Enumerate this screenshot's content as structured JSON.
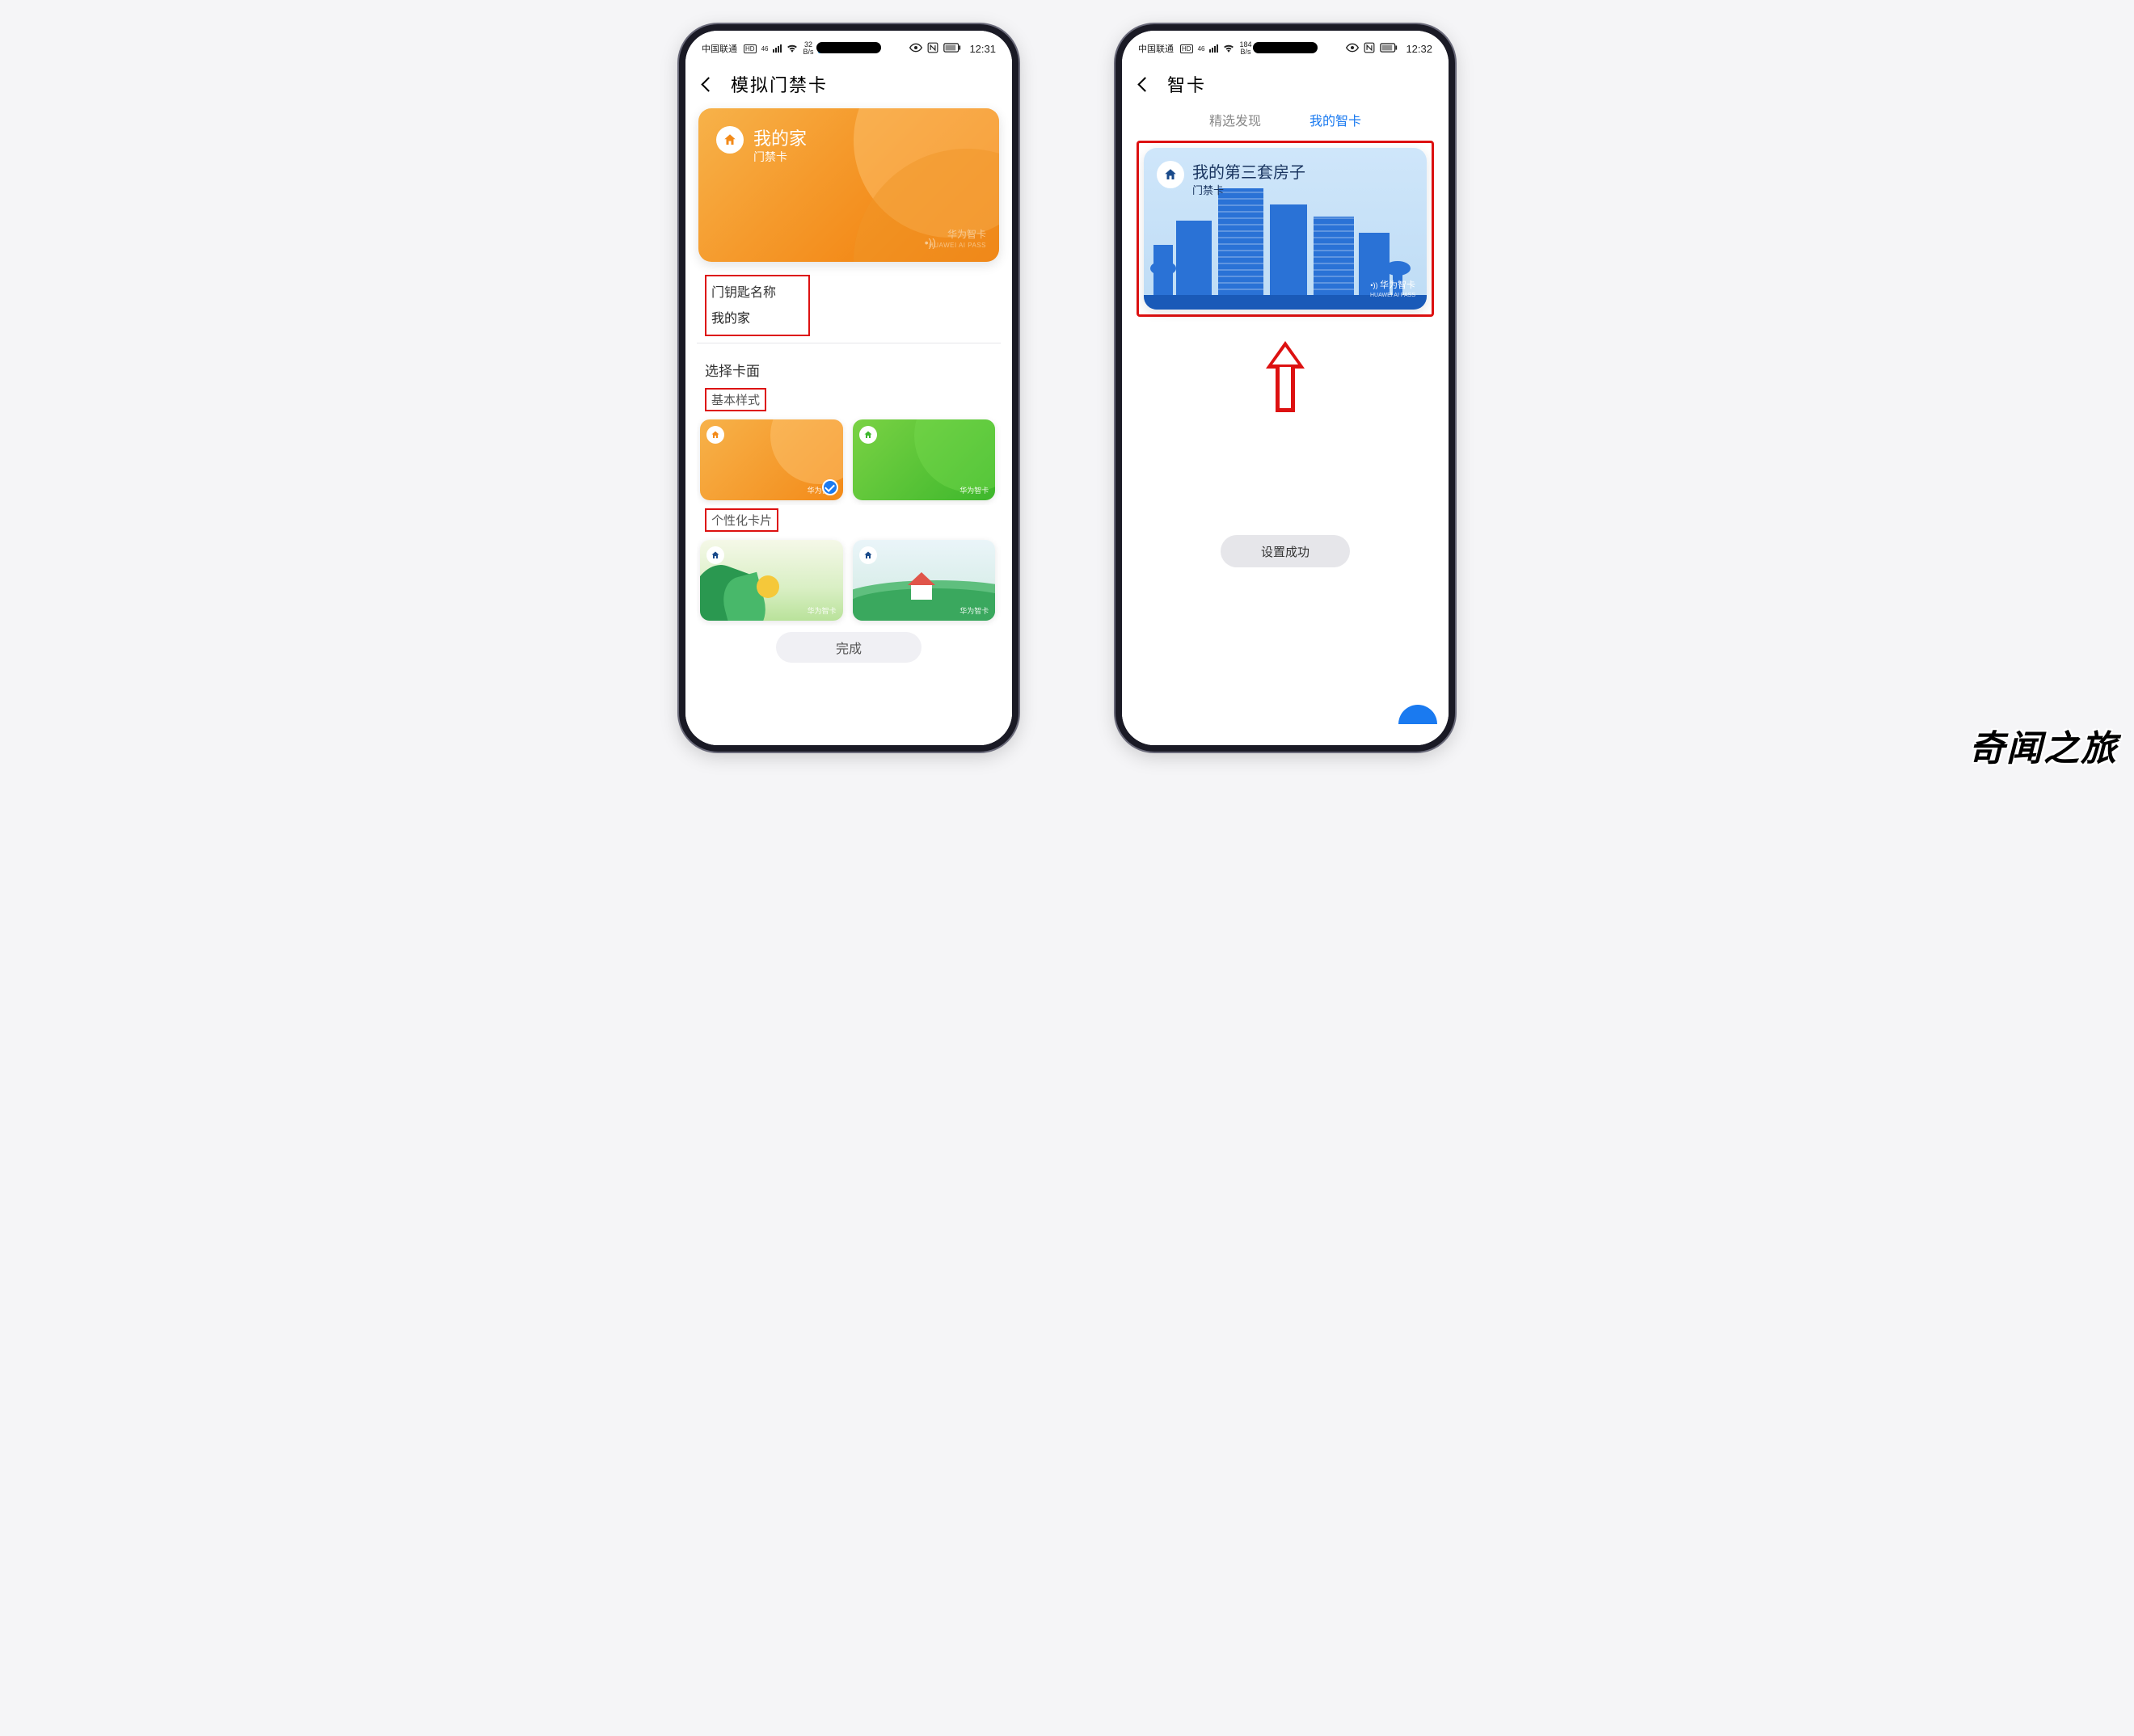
{
  "phone1": {
    "status": {
      "carrier": "中国联通",
      "hd": "HD",
      "net_rate": "32",
      "net_unit": "B/s",
      "time": "12:31",
      "sig": "46"
    },
    "title": "模拟门禁卡",
    "card": {
      "name": "我的家",
      "type": "门禁卡",
      "brand": "华为智卡",
      "brand_en": "HUAWEI AI PASS"
    },
    "form": {
      "label": "门钥匙名称",
      "value": "我的家"
    },
    "choose_skin": "选择卡面",
    "basic_label": "基本样式",
    "personal_label": "个性化卡片",
    "thumb_brand": "华为智卡",
    "done": "完成"
  },
  "phone2": {
    "status": {
      "carrier": "中国联通",
      "hd": "HD",
      "net_rate": "184",
      "net_unit": "B/s",
      "time": "12:32",
      "sig": "46"
    },
    "title": "智卡",
    "tabs": {
      "discover": "精选发现",
      "mine": "我的智卡"
    },
    "card": {
      "name": "我的第三套房子",
      "type": "门禁卡",
      "brand": "华为智卡",
      "brand_en": "HUAWEI AI PASS"
    },
    "toast": "设置成功"
  },
  "watermark": "奇闻之旅"
}
